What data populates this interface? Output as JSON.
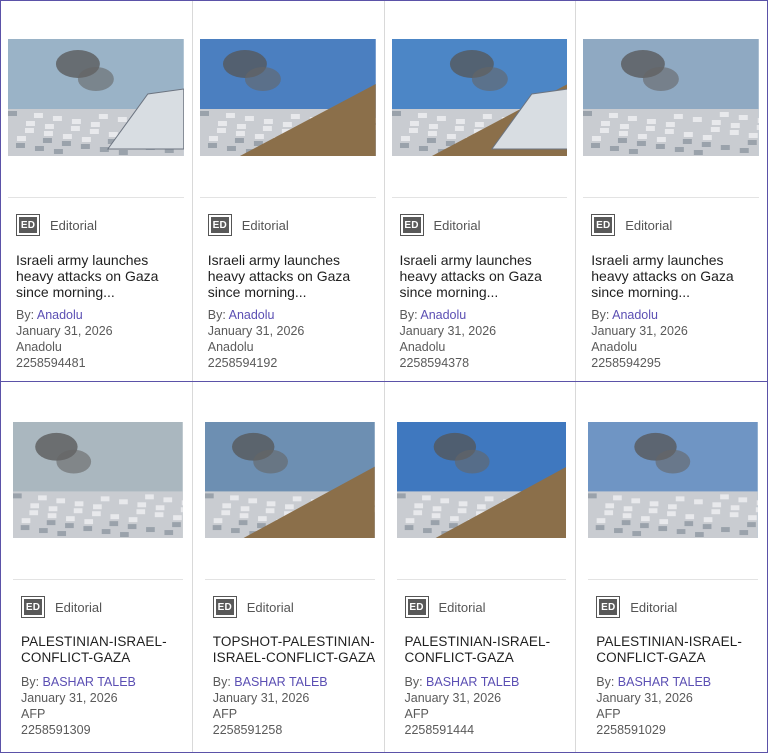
{
  "colors": {
    "border": "#5b52a8",
    "link": "#5b4fb3",
    "badge": "#595959"
  },
  "cards": [
    {
      "collection": "Editorial",
      "badge": "ED",
      "title": "Israeli army launches heavy attacks on Gaza since morning...",
      "by_label": "By:",
      "author": "Anadolu",
      "date": "January 31, 2026",
      "credit": "Anadolu",
      "id": "2258594481"
    },
    {
      "collection": "Editorial",
      "badge": "ED",
      "title": "Israeli army launches heavy attacks on Gaza since morning...",
      "by_label": "By:",
      "author": "Anadolu",
      "date": "January 31, 2026",
      "credit": "Anadolu",
      "id": "2258594192"
    },
    {
      "collection": "Editorial",
      "badge": "ED",
      "title": "Israeli army launches heavy attacks on Gaza since morning...",
      "by_label": "By:",
      "author": "Anadolu",
      "date": "January 31, 2026",
      "credit": "Anadolu",
      "id": "2258594378"
    },
    {
      "collection": "Editorial",
      "badge": "ED",
      "title": "Israeli army launches heavy attacks on Gaza since morning...",
      "by_label": "By:",
      "author": "Anadolu",
      "date": "January 31, 2026",
      "credit": "Anadolu",
      "id": "2258594295"
    },
    {
      "collection": "Editorial",
      "badge": "ED",
      "title": "PALESTINIAN-ISRAEL-CONFLICT-GAZA",
      "by_label": "By:",
      "author": "BASHAR TALEB",
      "date": "January 31, 2026",
      "credit": "AFP",
      "id": "2258591309"
    },
    {
      "collection": "Editorial",
      "badge": "ED",
      "title": "TOPSHOT-PALESTINIAN-ISRAEL-CONFLICT-GAZA",
      "by_label": "By:",
      "author": "BASHAR TALEB",
      "date": "January 31, 2026",
      "credit": "AFP",
      "id": "2258591258"
    },
    {
      "collection": "Editorial",
      "badge": "ED",
      "title": "PALESTINIAN-ISRAEL-CONFLICT-GAZA",
      "by_label": "By:",
      "author": "BASHAR TALEB",
      "date": "January 31, 2026",
      "credit": "AFP",
      "id": "2258591444"
    },
    {
      "collection": "Editorial",
      "badge": "ED",
      "title": "PALESTINIAN-ISRAEL-CONFLICT-GAZA",
      "by_label": "By:",
      "author": "BASHAR TALEB",
      "date": "January 31, 2026",
      "credit": "AFP",
      "id": "2258591029"
    }
  ]
}
